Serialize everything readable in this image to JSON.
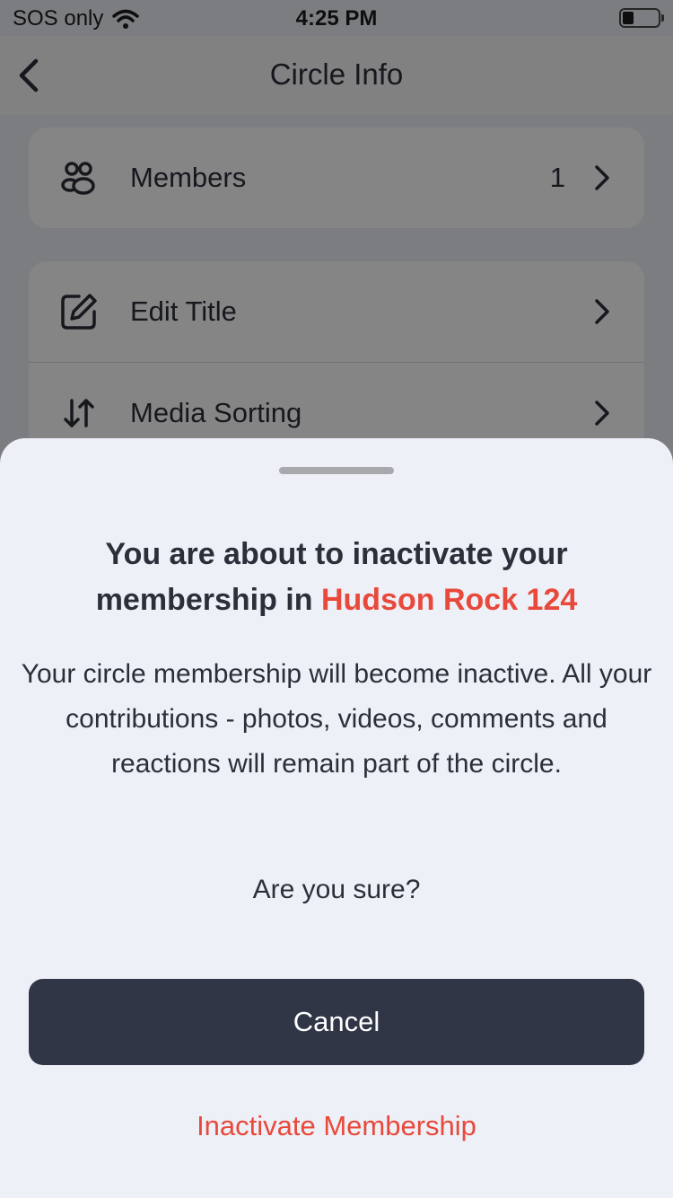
{
  "status_bar": {
    "carrier": "SOS only",
    "time": "4:25 PM"
  },
  "nav": {
    "title": "Circle Info"
  },
  "groups": [
    {
      "items": [
        {
          "icon": "members-icon",
          "label": "Members",
          "count": "1"
        }
      ]
    },
    {
      "items": [
        {
          "icon": "edit-icon",
          "label": "Edit Title"
        },
        {
          "icon": "sort-icon",
          "label": "Media Sorting"
        }
      ]
    }
  ],
  "sheet": {
    "title_prefix": "You are about to inactivate your membership in",
    "circle_name": "Hudson Rock 124",
    "body": "Your circle membership will become inactive. All your contributions - photos, videos, comments and reactions will remain part of the circle.",
    "question": "Are you sure?",
    "cancel_label": "Cancel",
    "inactivate_label": "Inactivate Membership"
  },
  "colors": {
    "accent": "#e8493b",
    "primary_button": "#303646",
    "sheet_background": "#eef0f7"
  }
}
